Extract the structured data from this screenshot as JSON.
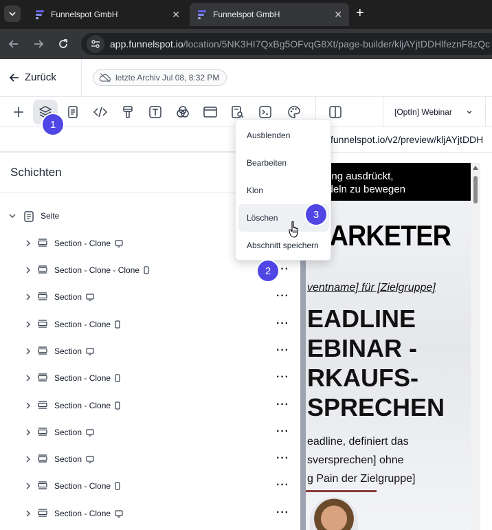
{
  "browser": {
    "tabs": [
      {
        "title": "Funnelspot GmbH",
        "active": false
      },
      {
        "title": "Funnelspot GmbH",
        "active": true
      }
    ],
    "url_host": "app.funnelspot.io",
    "url_path": "/location/5NK3HI7QxBg5OFvqG8Xt/page-builder/kljAYjtDDHlfeznF8zQc"
  },
  "header": {
    "back_label": "Zurück",
    "archive_label": "letzte Archiv Jul 08, 8:32 PM"
  },
  "toolbar": {
    "page_select": "[OptIn] Webinar"
  },
  "preview": {
    "url": "funnelspot.io/v2/preview/kljAYjtDDH",
    "banner_line1": "appung ausdrückt,",
    "banner_line2": "Handeln zu bewegen",
    "logo_text": "MARKETER",
    "tagline": "ventname] für [Zielgruppe]",
    "headline": [
      "EADLINE",
      "EBINAR -",
      "RKAUFS-",
      "SPRECHEN"
    ],
    "body": [
      "eadline, definiert das",
      "sversprechen] ohne",
      "g Pain der Zielgruppe]"
    ]
  },
  "layers": {
    "title": "Schichten",
    "root_label": "Seite",
    "rows": [
      {
        "label": "Section - Clone",
        "device": "desktop",
        "more": ""
      },
      {
        "label": "Section - Clone - Clone",
        "device": "mobile",
        "more": "···"
      },
      {
        "label": "Section",
        "device": "desktop",
        "more": "···"
      },
      {
        "label": "Section - Clone",
        "device": "mobile",
        "more": "···"
      },
      {
        "label": "Section",
        "device": "desktop",
        "more": "···"
      },
      {
        "label": "Section - Clone",
        "device": "mobile",
        "more": "···"
      },
      {
        "label": "Section - Clone",
        "device": "mobile",
        "more": "···"
      },
      {
        "label": "Section",
        "device": "desktop",
        "more": "···"
      },
      {
        "label": "Section",
        "device": "desktop",
        "more": "···"
      },
      {
        "label": "Section - Clone",
        "device": "mobile",
        "more": "···"
      },
      {
        "label": "Section - Clone",
        "device": "desktop",
        "more": "···"
      }
    ]
  },
  "context_menu": {
    "items": [
      "Ausblenden",
      "Bearbeiten",
      "Klon",
      "Löschen",
      "Abschnitt speichern"
    ],
    "hovered_index": 3
  },
  "badges": [
    "1",
    "2",
    "3"
  ],
  "colors": {
    "badge": "#4f46e5",
    "chrome_dark": "#1f1f1f",
    "chrome_mid": "#35363a"
  }
}
